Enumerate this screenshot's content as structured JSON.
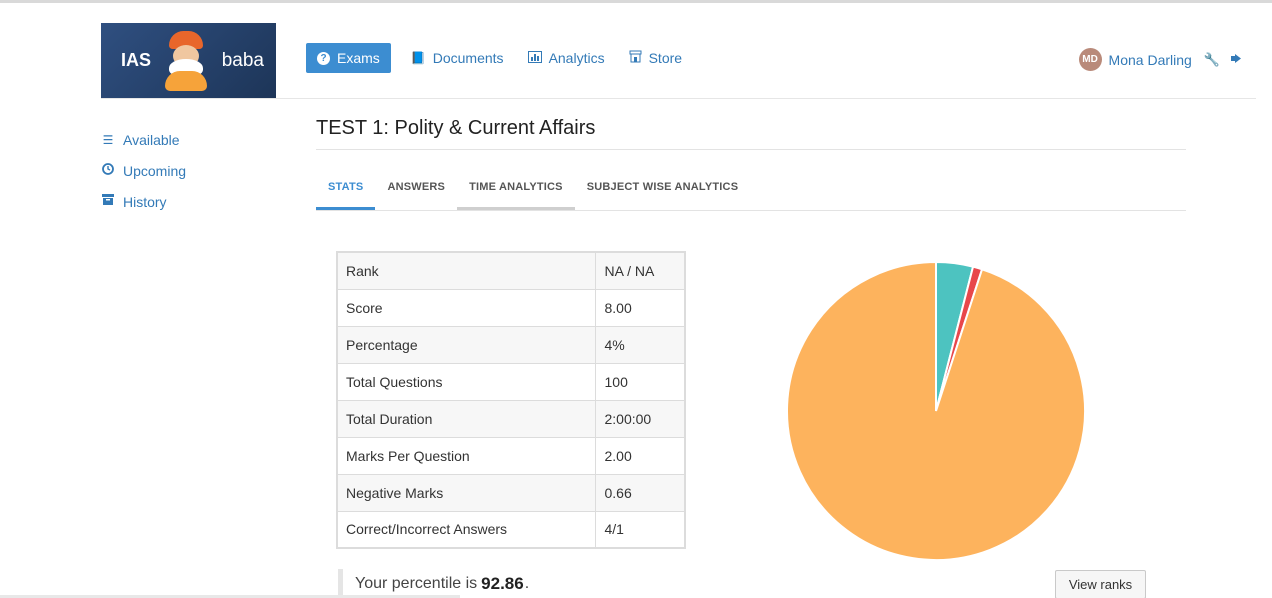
{
  "brand": {
    "left": "IAS",
    "right": "baba"
  },
  "nav": [
    {
      "label": "Exams",
      "icon": "question-circle-icon",
      "active": true
    },
    {
      "label": "Documents",
      "icon": "book-icon"
    },
    {
      "label": "Analytics",
      "icon": "bar-chart-icon"
    },
    {
      "label": "Store",
      "icon": "store-icon"
    }
  ],
  "user": {
    "initials": "MD",
    "name": "Mona Darling"
  },
  "sidebar": [
    {
      "label": "Available",
      "icon": "list-icon"
    },
    {
      "label": "Upcoming",
      "icon": "clock-icon"
    },
    {
      "label": "History",
      "icon": "archive-icon"
    }
  ],
  "page": {
    "title": "TEST 1: Polity & Current Affairs"
  },
  "tabs": [
    {
      "label": "STATS"
    },
    {
      "label": "ANSWERS"
    },
    {
      "label": "TIME ANALYTICS"
    },
    {
      "label": "SUBJECT WISE ANALYTICS"
    }
  ],
  "stats": [
    {
      "label": "Rank",
      "value": "NA / NA"
    },
    {
      "label": "Score",
      "value": "8.00"
    },
    {
      "label": "Percentage",
      "value": "4%"
    },
    {
      "label": "Total Questions",
      "value": "100"
    },
    {
      "label": "Total Duration",
      "value": "2:00:00"
    },
    {
      "label": "Marks Per Question",
      "value": "2.00"
    },
    {
      "label": "Negative Marks",
      "value": "0.66"
    },
    {
      "label": "Correct/Incorrect Answers",
      "value": "4/1"
    }
  ],
  "percentile": {
    "prefix": "Your percentile is",
    "value": "92.86",
    "suffix": "."
  },
  "buttons": {
    "view_ranks": "View ranks"
  },
  "chart_data": {
    "type": "pie",
    "slices": [
      {
        "value": 4,
        "color": "#4dc3c0"
      },
      {
        "value": 1,
        "color": "#e8474b"
      },
      {
        "value": 95,
        "color": "#fdb35d"
      }
    ]
  }
}
